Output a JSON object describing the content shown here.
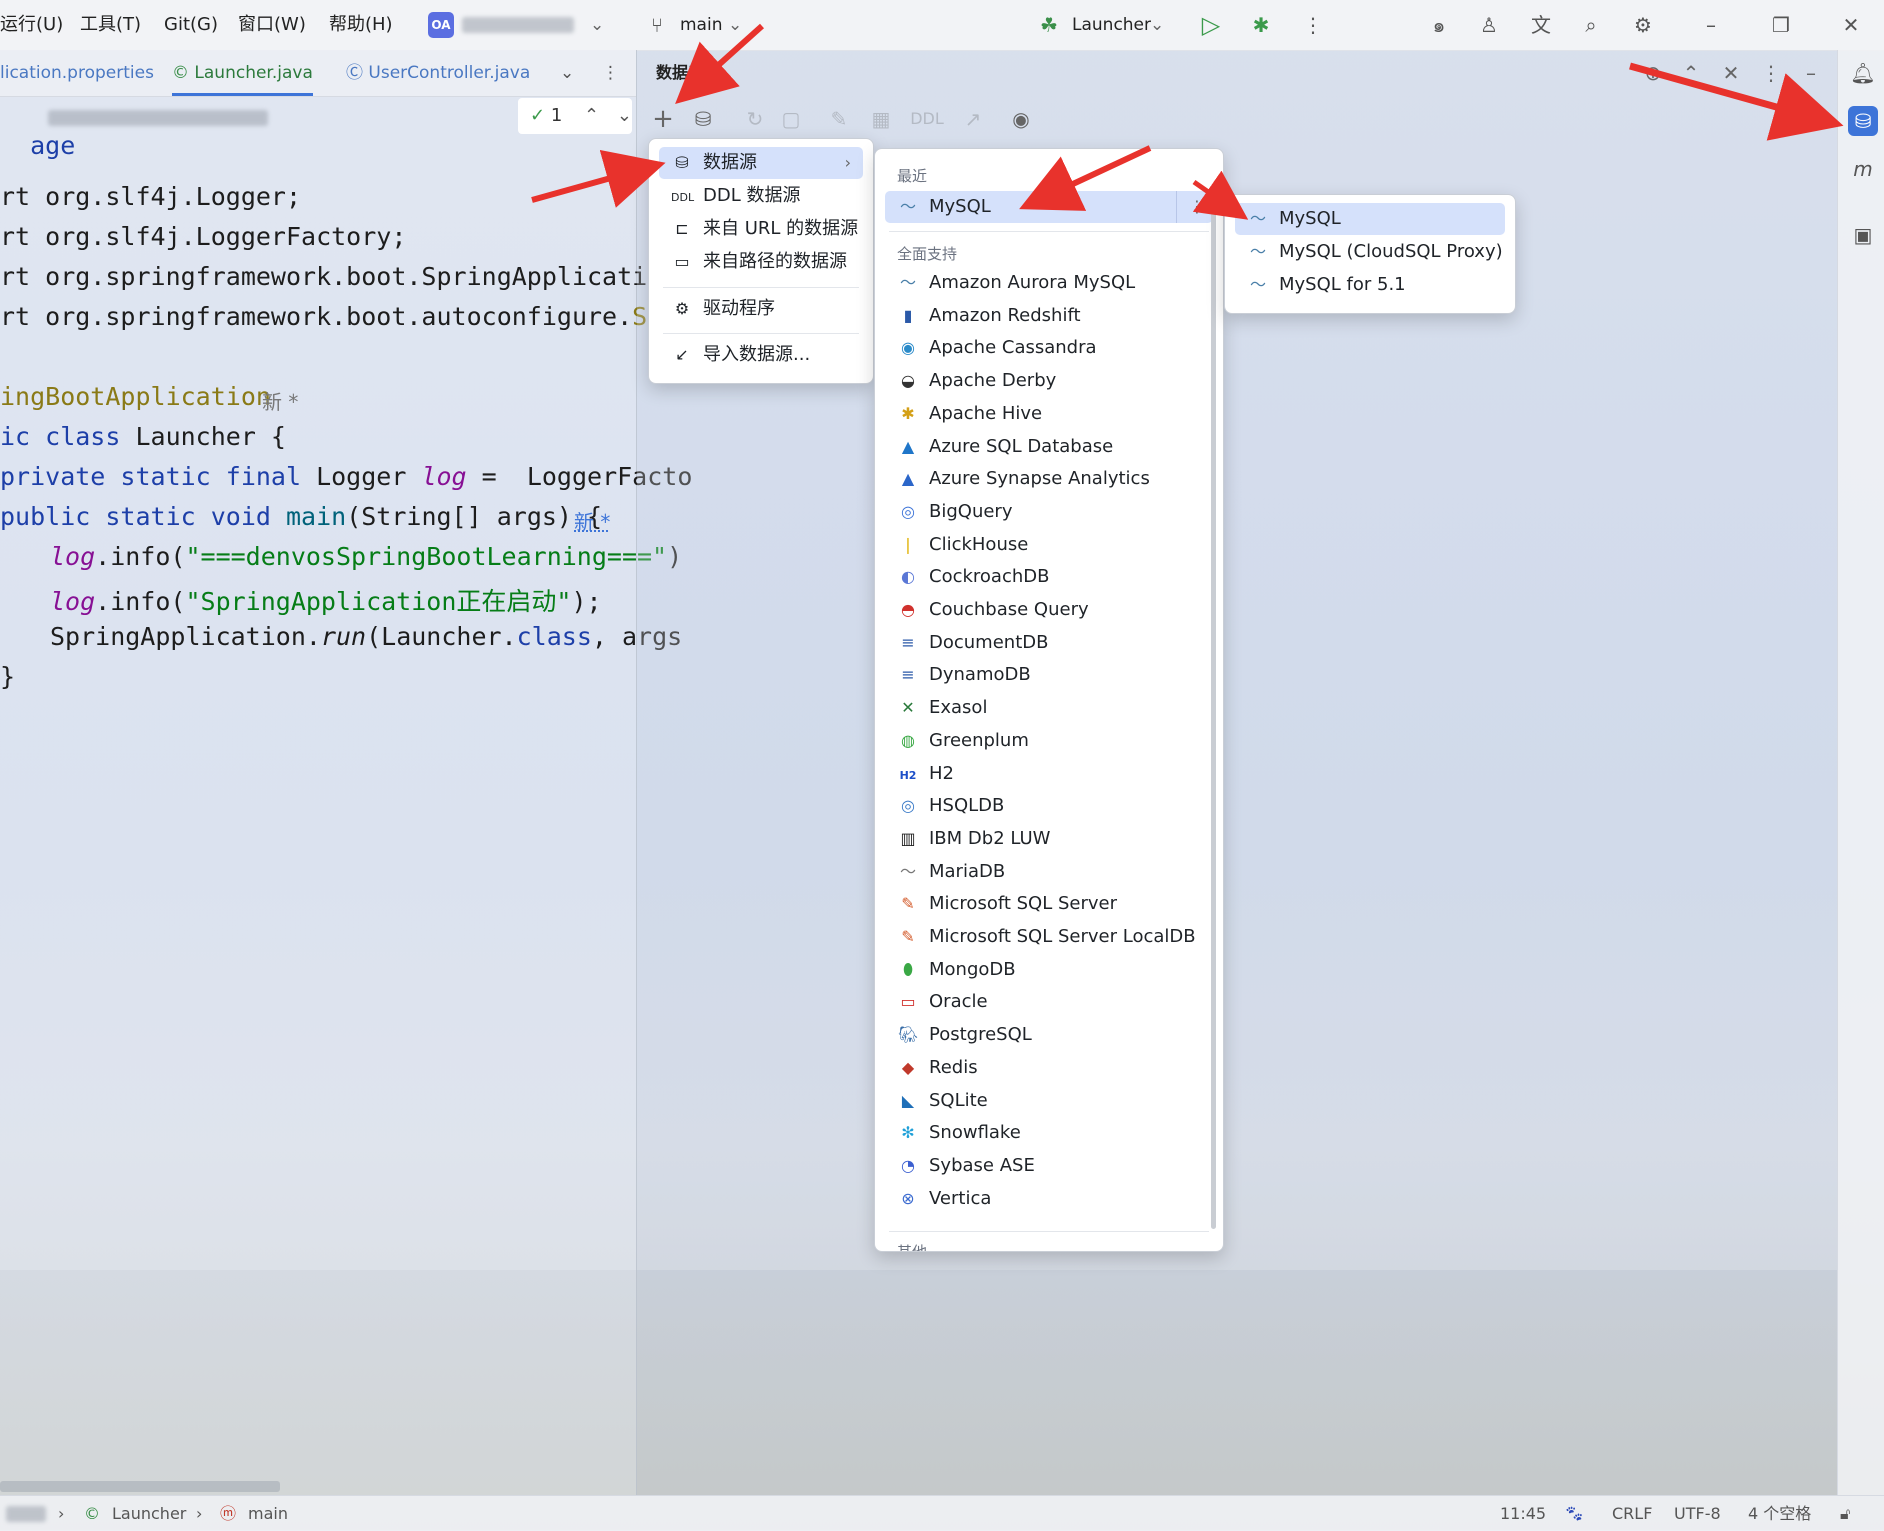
{
  "menubar": {
    "items": [
      "运行(U)",
      "工具(T)",
      "Git(G)",
      "窗口(W)",
      "帮助(H)"
    ],
    "project_badge": "OA",
    "branch": "main",
    "run_config": "Launcher"
  },
  "tabs": [
    "lication.properties",
    "Launcher.java",
    "UserController.java"
  ],
  "editor": {
    "line1": "age",
    "inspection_count": "1",
    "imports": [
      "rt org.slf4j.Logger;",
      "rt org.slf4j.LoggerFactory;",
      "rt org.springframework.boot.SpringApplication;",
      "rt org.springframework.boot.autoconfigure."
    ],
    "import4_tail": "Spri",
    "annotation": "ingBootApplication",
    "annotation_hint": "新 *",
    "class_kw": "ic class",
    "class_name": " Launcher {",
    "field_kw": "private static final",
    "field_type": " Logger ",
    "field_name": "log",
    "field_rest": " =  LoggerFacto",
    "main_kw": "public static void",
    "main_name": " main",
    "main_rest": "(String[] args) {",
    "main_hint": "新 *",
    "log1_var": "log",
    "log1_call": ".info(",
    "log1_str": "\"===denvosSpringBootLearning===\"",
    "log1_end": ")",
    "log2_var": "log",
    "log2_call": ".info(",
    "log2_str": "\"SpringApplication正在启动\"",
    "log2_end": ");",
    "run_pre": "SpringApplication.",
    "run_method": "run",
    "run_mid": "(Launcher.",
    "run_kw": "class",
    "run_end": ", args",
    "close": "}"
  },
  "db_panel": {
    "title": "数据库",
    "ddl_label": "DDL"
  },
  "menu1": {
    "items": [
      {
        "label": "数据源",
        "icon": "database-icon",
        "selected": true,
        "submenu": true
      },
      {
        "label": "DDL 数据源",
        "icon": "ddl-icon"
      },
      {
        "label": "来自 URL 的数据源",
        "icon": "url-icon"
      },
      {
        "label": "来自路径的数据源",
        "icon": "folder-icon"
      },
      {
        "label": "驱动程序",
        "icon": "driver-icon"
      },
      {
        "label": "导入数据源...",
        "icon": "import-icon"
      }
    ]
  },
  "menu2": {
    "recent_label": "最近",
    "recent": "MySQL",
    "full_label": "全面支持",
    "items": [
      "Amazon Aurora MySQL",
      "Amazon Redshift",
      "Apache Cassandra",
      "Apache Derby",
      "Apache Hive",
      "Azure SQL Database",
      "Azure Synapse Analytics",
      "BigQuery",
      "ClickHouse",
      "CockroachDB",
      "Couchbase Query",
      "DocumentDB",
      "DynamoDB",
      "Exasol",
      "Greenplum",
      "H2",
      "HSQLDB",
      "IBM Db2 LUW",
      "MariaDB",
      "Microsoft SQL Server",
      "Microsoft SQL Server LocalDB",
      "MongoDB",
      "Oracle",
      "PostgreSQL",
      "Redis",
      "SQLite",
      "Snowflake",
      "Sybase ASE",
      "Vertica"
    ],
    "other_label": "其他"
  },
  "menu3": {
    "items": [
      "MySQL",
      "MySQL (CloudSQL Proxy)",
      "MySQL for 5.1"
    ]
  },
  "statusbar": {
    "breadcrumb1": "Launcher",
    "breadcrumb2": "main",
    "time": "11:45",
    "line_sep": "CRLF",
    "encoding": "UTF-8",
    "indent": "4 个空格"
  },
  "colors": {
    "accent": "#3d74d8",
    "selection": "#d5e1fb",
    "arrow_red": "#e8322c"
  }
}
